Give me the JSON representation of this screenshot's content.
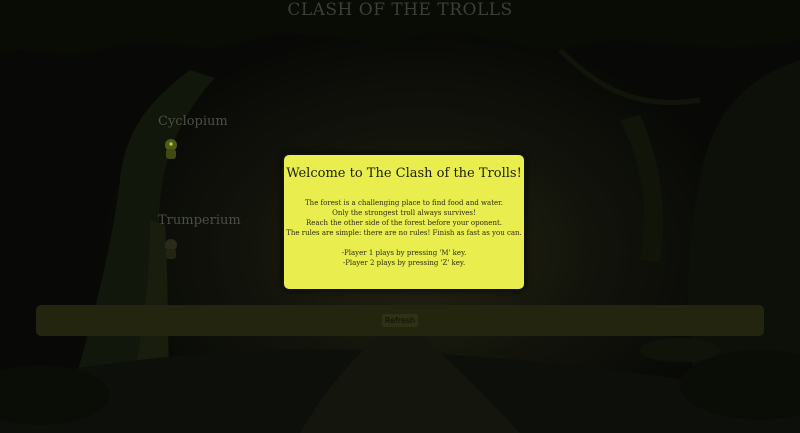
{
  "game": {
    "title": "CLASH OF THE TROLLS"
  },
  "players": [
    {
      "name": "Cyclopium"
    },
    {
      "name": "Trumperium"
    }
  ],
  "refresh": {
    "label": "Refresh"
  },
  "modal": {
    "title": "Welcome to The Clash of the Trolls!",
    "intro_lines": [
      "The forest is a challenging place to find food and water.",
      "Only the strongest troll always survives!",
      "Reach the other side of the forest before your oponent.",
      "The rules are simple: there are no rules! Finish as fast as you can."
    ],
    "control_lines": [
      "-Player 1 plays by pressing 'M' key.",
      "-Player 2 plays by pressing 'Z' key."
    ]
  },
  "colors": {
    "modal_background": "#e9ed4e",
    "refresh_bar": "#24250e",
    "scene_dark": "#0d0f0a"
  }
}
